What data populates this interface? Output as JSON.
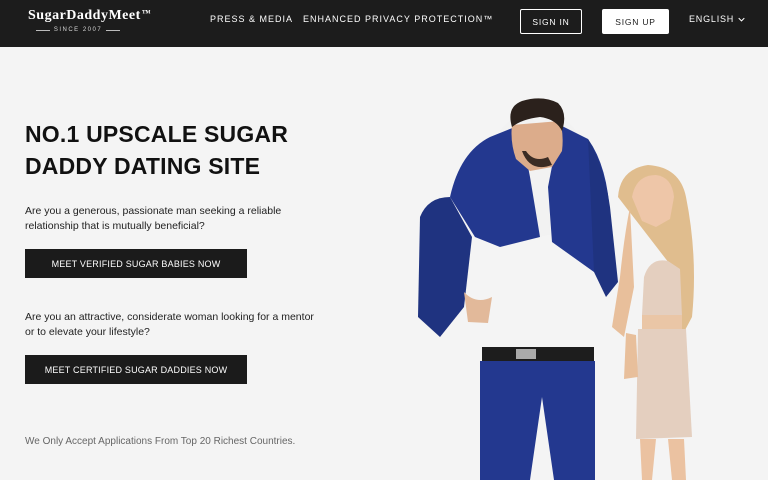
{
  "header": {
    "logo_main": "SugarDaddyMeet",
    "logo_tm": "™",
    "logo_sub": "SINCE 2007",
    "nav": [
      "PRESS & MEDIA",
      "ENHANCED PRIVACY PROTECTION™"
    ],
    "sign_in": "SIGN IN",
    "sign_up": "SIGN UP",
    "language": "ENGLISH"
  },
  "hero": {
    "headline_line1": "NO.1 UPSCALE SUGAR",
    "headline_line2": "DADDY DATING SITE",
    "men_question": "Are you a generous, passionate man seeking a reliable relationship that is mutually beneficial?",
    "men_cta": "MEET VERIFIED SUGAR BABIES NOW",
    "women_question": "Are you an attractive, considerate woman looking for a mentor or to elevate your lifestyle?",
    "women_cta": "MEET CERTIFIED SUGAR DADDIES NOW",
    "note": "We Only Accept Applications From Top 20 Richest Countries."
  },
  "colors": {
    "header_bg": "#1c1c1c",
    "page_bg": "#f4f4f4",
    "cta_bg": "#1b1b1b",
    "suit_blue": "#23388f"
  },
  "icons": {
    "language_dropdown": "chevron-down-icon"
  }
}
